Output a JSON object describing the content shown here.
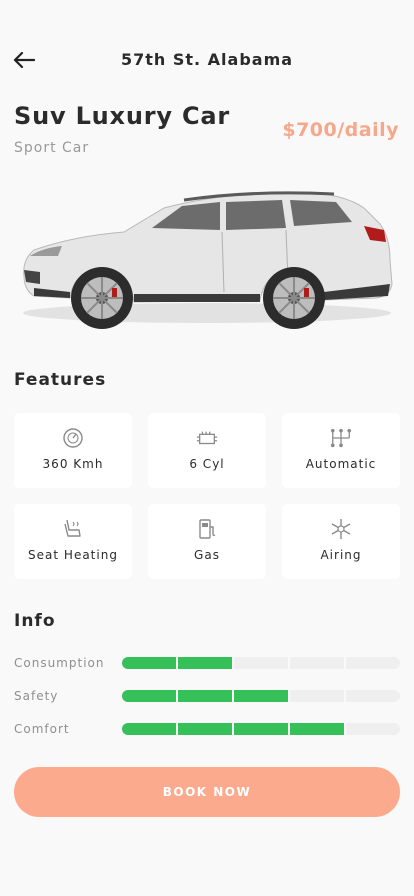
{
  "header": {
    "title": "57th St. Alabama",
    "back_icon": "arrow-left-icon"
  },
  "car": {
    "name": "Suv Luxury Car",
    "type": "Sport Car",
    "price": "$700/daily",
    "body_color": "#e8e8e8"
  },
  "features": {
    "title": "Features",
    "items": [
      {
        "label": "360 Kmh",
        "icon": "speedometer-icon"
      },
      {
        "label": "6 Cyl",
        "icon": "engine-icon"
      },
      {
        "label": "Automatic",
        "icon": "gearbox-icon"
      },
      {
        "label": "Seat Heating",
        "icon": "seat-heating-icon"
      },
      {
        "label": "Gas",
        "icon": "fuel-pump-icon"
      },
      {
        "label": "Airing",
        "icon": "snowflake-icon"
      }
    ]
  },
  "info": {
    "title": "Info",
    "segments_total": 5,
    "rows": [
      {
        "label": "Consumption",
        "level": 2
      },
      {
        "label": "Safety",
        "level": 3
      },
      {
        "label": "Comfort",
        "level": 4
      }
    ]
  },
  "cta": {
    "label": "BOOK NOW"
  },
  "colors": {
    "accent": "#fcaa8d",
    "price": "#f5a88a",
    "bar_on": "#35c05a",
    "bar_off": "#efefef",
    "background": "#f9f9f9"
  }
}
